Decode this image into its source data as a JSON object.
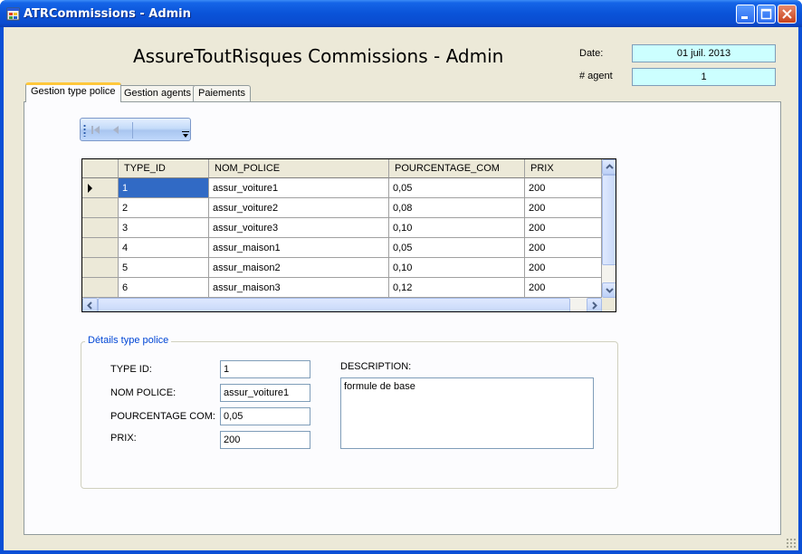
{
  "window": {
    "title": "ATRCommissions - Admin",
    "colors": {
      "titlebar": "#0a4fd6",
      "client": "#ece9d8",
      "info_field": "#ccffff",
      "selection": "#316ac5",
      "group_legend": "#0046d5",
      "active_tab_accent": "#ffc73c"
    }
  },
  "header": {
    "title": "AssureToutRisques Commissions - Admin",
    "date_label": "Date:",
    "date_value": "01 juil. 2013",
    "agent_label": "# agent",
    "agent_value": "1"
  },
  "tabs": [
    {
      "label": "Gestion type police",
      "active": true
    },
    {
      "label": "Gestion agents",
      "active": false
    },
    {
      "label": "Paiements",
      "active": false
    }
  ],
  "navigator": {
    "icons": [
      "move-first-icon",
      "move-previous-icon",
      "dropdown-icon"
    ]
  },
  "grid": {
    "columns": [
      "TYPE_ID",
      "NOM_POLICE",
      "POURCENTAGE_COM",
      "PRIX"
    ],
    "rows": [
      [
        "1",
        "assur_voiture1",
        "0,05",
        "200"
      ],
      [
        "2",
        "assur_voiture2",
        "0,08",
        "200"
      ],
      [
        "3",
        "assur_voiture3",
        "0,10",
        "200"
      ],
      [
        "4",
        "assur_maison1",
        "0,05",
        "200"
      ],
      [
        "5",
        "assur_maison2",
        "0,10",
        "200"
      ],
      [
        "6",
        "assur_maison3",
        "0,12",
        "200"
      ]
    ],
    "selected_row": 0
  },
  "details": {
    "legend": "Détails type police",
    "type_id_label": "TYPE ID:",
    "type_id_value": "1",
    "nom_police_label": "NOM POLICE:",
    "nom_police_value": "assur_voiture1",
    "pourcentage_label": "POURCENTAGE COM:",
    "pourcentage_value": "0,05",
    "prix_label": "PRIX:",
    "prix_value": "200",
    "description_label": "DESCRIPTION:",
    "description_value": "formule de base"
  }
}
